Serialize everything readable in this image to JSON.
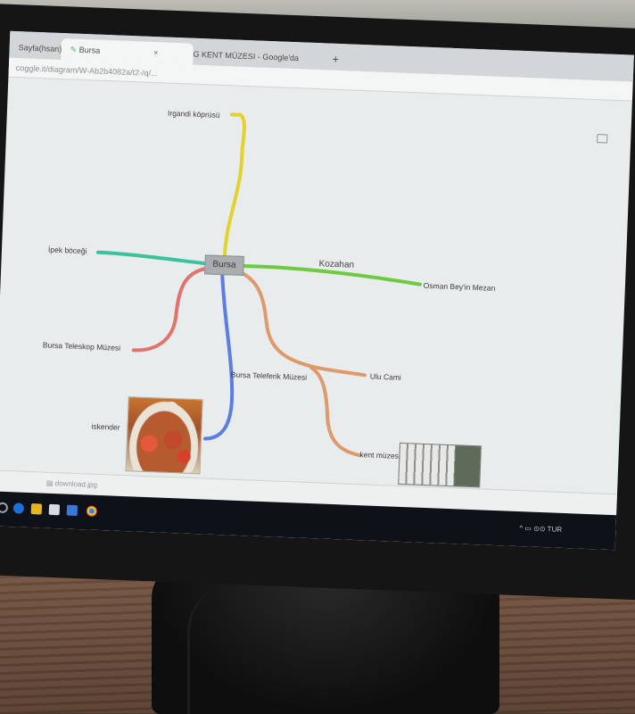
{
  "browser": {
    "tabs": [
      {
        "label": "Sayfa(hsan) ×"
      },
      {
        "label": "Bursa",
        "close": "×"
      },
      {
        "label": "G  KENT MÜZESI - Google'da Ara",
        "close": "×"
      },
      {
        "label": "+"
      }
    ],
    "address": "coggle.it/diagram/W-Ab2b4082a/t2-/q/..."
  },
  "mindmap": {
    "center": "Bursa",
    "branches": {
      "yellow": "Irgandi köprüsü",
      "teal": "İpek böceği",
      "green_above": "Kozahan",
      "green_end": "Osman Bey'in Mezarı",
      "red": "Bursa Teleskop Müzesi",
      "blue_mid": "Bursa Teleferik Müzesi",
      "blue_end": "iskender",
      "orange_a": "Ulu Cami",
      "orange_b": "kent müzesi"
    },
    "colors": {
      "yellow": "#e3d22c",
      "teal": "#39c39a",
      "green": "#6ccb3f",
      "red": "#e0746c",
      "blue": "#5a7fe0",
      "orange": "#de9a6a"
    }
  },
  "downloads": {
    "file": "download.jpg"
  },
  "taskbar": {
    "tray_text": "^ ▭ ⊙⊙  TUR"
  }
}
